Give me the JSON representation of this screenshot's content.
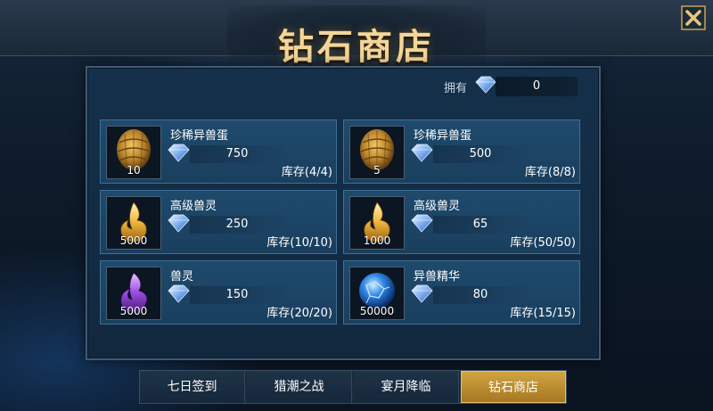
{
  "header": {
    "title": "钻石商店"
  },
  "balance": {
    "label": "拥有",
    "value": "0"
  },
  "items": [
    {
      "name": "珍稀异兽蛋",
      "quantity": "10",
      "price": "750",
      "stock": "库存(4/4)",
      "icon": "golden-egg-icon"
    },
    {
      "name": "珍稀异兽蛋",
      "quantity": "5",
      "price": "500",
      "stock": "库存(8/8)",
      "icon": "golden-egg-icon"
    },
    {
      "name": "高级兽灵",
      "quantity": "5000",
      "price": "250",
      "stock": "库存(10/10)",
      "icon": "golden-flame-icon"
    },
    {
      "name": "高级兽灵",
      "quantity": "1000",
      "price": "65",
      "stock": "库存(50/50)",
      "icon": "golden-flame-icon"
    },
    {
      "name": "兽灵",
      "quantity": "5000",
      "price": "150",
      "stock": "库存(20/20)",
      "icon": "purple-flame-icon"
    },
    {
      "name": "异兽精华",
      "quantity": "50000",
      "price": "80",
      "stock": "库存(15/15)",
      "icon": "blue-orb-icon"
    }
  ],
  "tabs": [
    {
      "label": "七日签到",
      "active": false
    },
    {
      "label": "猎潮之战",
      "active": false
    },
    {
      "label": "宴月降临",
      "active": false
    },
    {
      "label": "钻石商店",
      "active": true
    }
  ],
  "colors": {
    "accent_gold": "#d2a440",
    "title_gold": "#f3d69a",
    "card_bg": "#1e4a6c"
  }
}
